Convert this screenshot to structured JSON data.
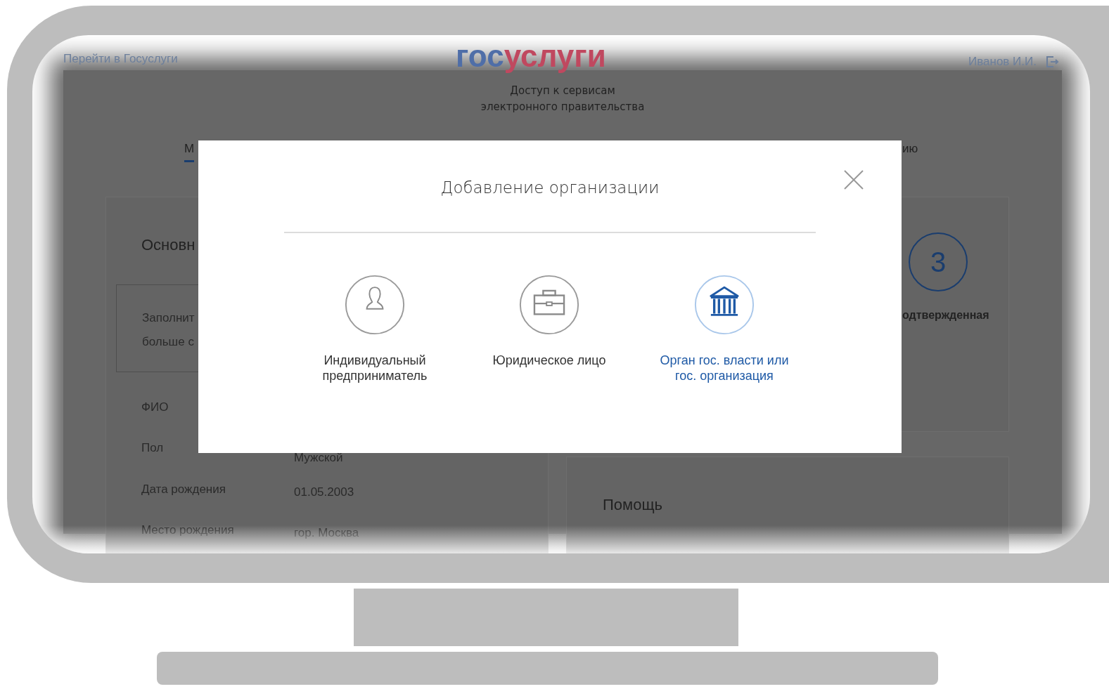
{
  "header": {
    "back_link": "Перейти в Госуслуги",
    "logo": [
      {
        "text": "гос",
        "color": "#4f6ea8"
      },
      {
        "text": "услуги",
        "color": "#c0485f"
      }
    ],
    "user_name": "Иванов И.И.",
    "subtitle": [
      "Доступ к сервисам",
      "электронного правительства"
    ]
  },
  "tabs": [
    {
      "label": "М",
      "selected": true
    },
    {
      "label": "ию",
      "selected": false
    }
  ],
  "profile_card": {
    "title": "Основн",
    "notice": [
      "Заполнит",
      "больше с"
    ],
    "fields": [
      {
        "label": "ФИО"
      },
      {
        "label": "Пол",
        "value": "Мужской"
      },
      {
        "label": "Дата рождения",
        "value": "01.05.2003"
      },
      {
        "label": "Место рождения",
        "value": "гор. Москва"
      }
    ]
  },
  "account_card": {
    "level_number": "3",
    "level_label": "одтвержденная"
  },
  "help_card": {
    "title": "Помощь"
  },
  "modal": {
    "title": "Добавление организации",
    "options": [
      {
        "kind": "person",
        "label": "Индивидуальный предприниматель",
        "selected": false
      },
      {
        "kind": "briefcase",
        "label": "Юридическое лицо",
        "selected": false
      },
      {
        "kind": "building",
        "label": "Орган гос. власти или гос. организация",
        "selected": true
      }
    ]
  }
}
